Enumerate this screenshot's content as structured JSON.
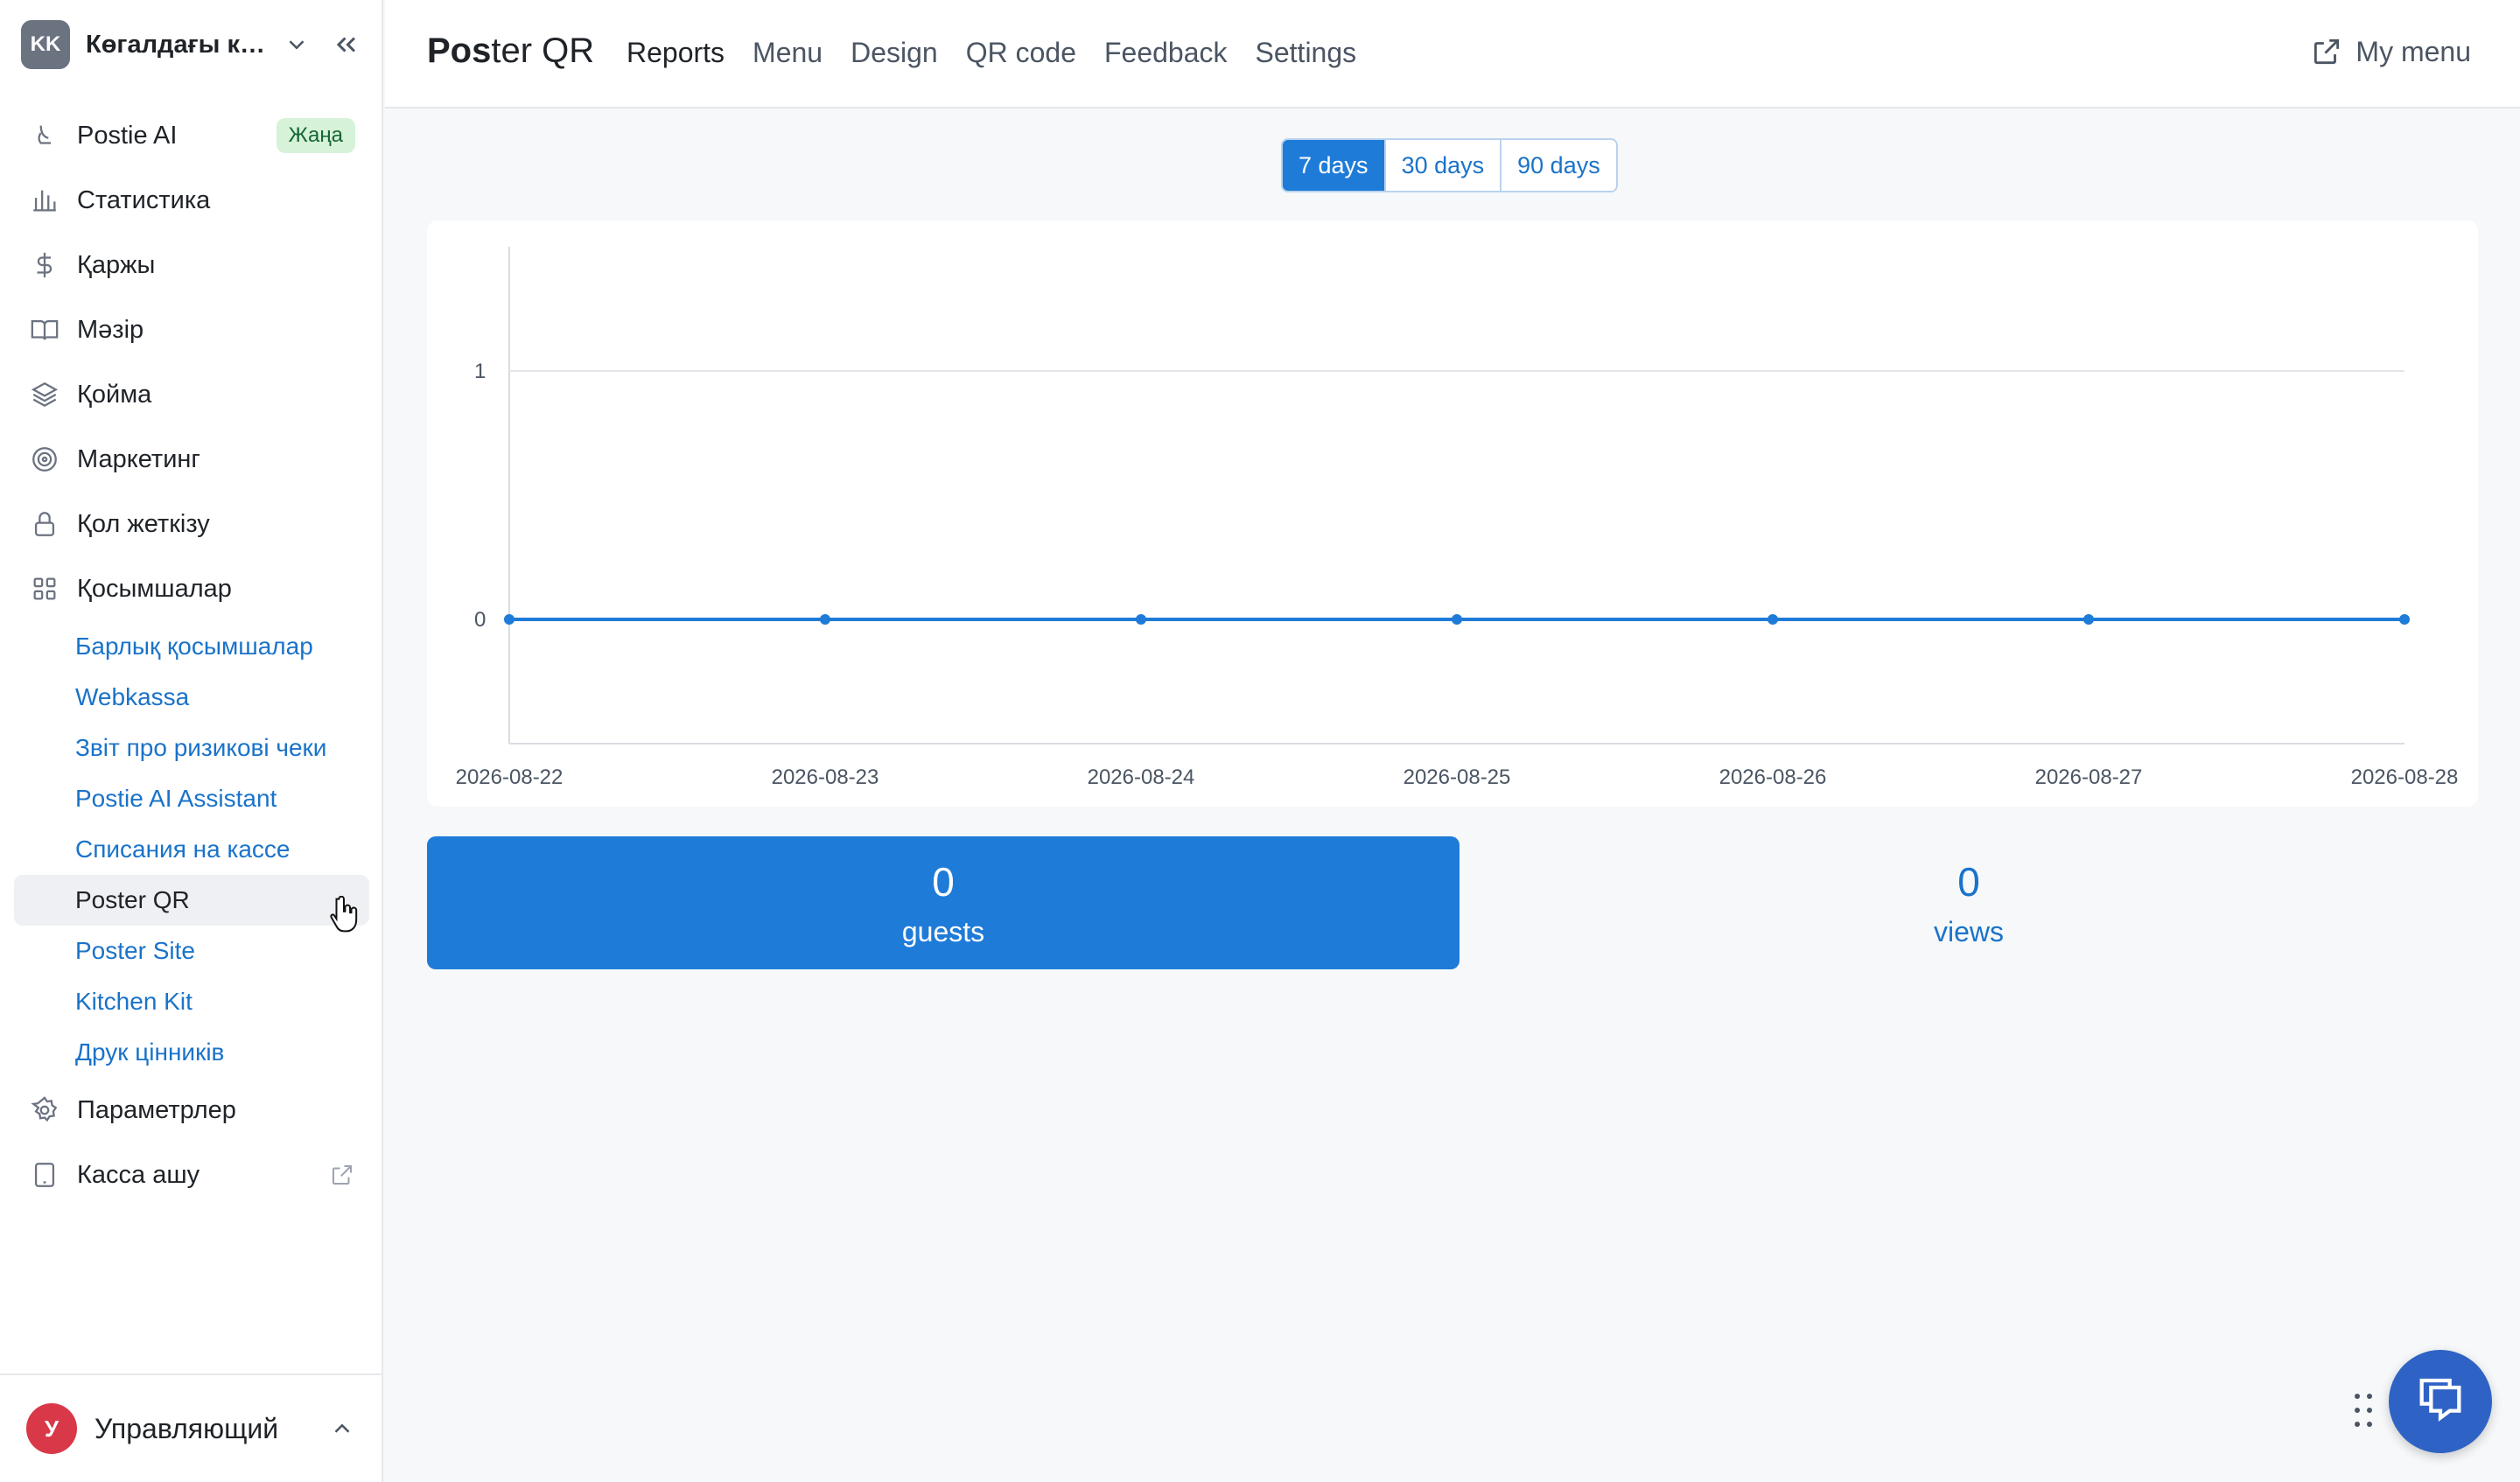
{
  "company": {
    "badge": "KK",
    "name": "Көгалдағы ка..."
  },
  "sidebar": {
    "items": [
      {
        "label": "Postie AI",
        "icon": "postie-ai-icon",
        "badge": "Жаңа"
      },
      {
        "label": "Статистика",
        "icon": "chart-icon"
      },
      {
        "label": "Қаржы",
        "icon": "dollar-icon"
      },
      {
        "label": "Мәзір",
        "icon": "book-icon"
      },
      {
        "label": "Қойма",
        "icon": "layers-icon"
      },
      {
        "label": "Маркетинг",
        "icon": "target-icon"
      },
      {
        "label": "Қол жеткізу",
        "icon": "lock-icon"
      },
      {
        "label": "Қосымшалар",
        "icon": "apps-icon"
      }
    ],
    "apps": [
      "Барлық қосымшалар",
      "Webkassa",
      "Звіт про ризикові чеки",
      "Postie AI Assistant",
      "Списания на кассе",
      "Poster QR",
      "Poster Site",
      "Kitchen Kit",
      "Друк цінників"
    ],
    "bottom_items": [
      {
        "label": "Параметрлер",
        "icon": "gear-icon"
      },
      {
        "label": "Касса ашу",
        "icon": "tablet-icon"
      }
    ]
  },
  "user": {
    "initial": "У",
    "name": "Управляющий"
  },
  "header": {
    "title_bold": "Pos",
    "title_rest": "ter QR",
    "tabs": [
      "Reports",
      "Menu",
      "Design",
      "QR code",
      "Feedback",
      "Settings"
    ],
    "my_menu": "My menu"
  },
  "period": {
    "options": [
      "7 days",
      "30 days",
      "90 days"
    ],
    "selected": "7 days"
  },
  "chart_data": {
    "type": "line",
    "x": [
      "2026-08-22",
      "2026-08-23",
      "2026-08-24",
      "2026-08-25",
      "2026-08-26",
      "2026-08-27",
      "2026-08-28"
    ],
    "series": [
      {
        "values": [
          0,
          0,
          0,
          0,
          0,
          0,
          0
        ]
      }
    ],
    "yticks": [
      "1",
      "0"
    ],
    "ylim": [
      -0.5,
      1.5
    ],
    "color": "#1f7bd8",
    "grid": true
  },
  "stats": {
    "guests": {
      "value": "0",
      "label": "guests"
    },
    "views": {
      "value": "0",
      "label": "views"
    }
  },
  "colors": {
    "accent": "#1f7bd8",
    "link": "#1a73c9",
    "new_badge": "#d6f2d8"
  }
}
